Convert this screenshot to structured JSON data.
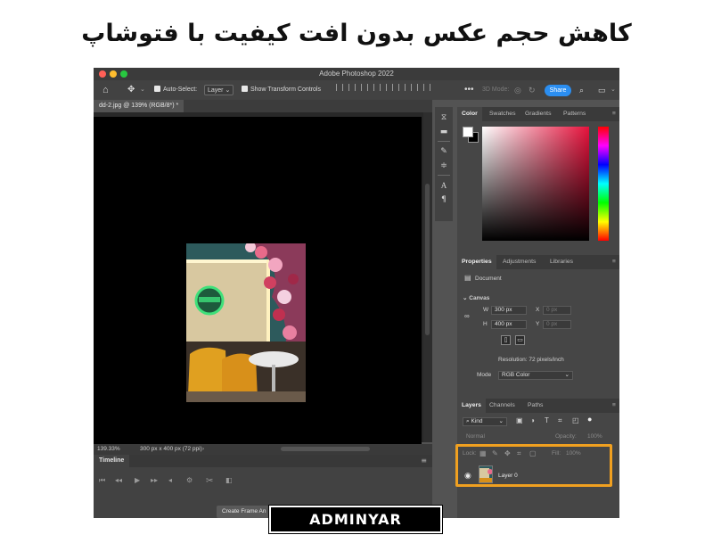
{
  "headline": "کاهش حجم عکس بدون افت کیفیت با فتوشاپ",
  "window": {
    "title": "Adobe Photoshop 2022"
  },
  "options_bar": {
    "auto_select_label": "Auto-Select:",
    "auto_select_value": "Layer",
    "show_transform_label": "Show Transform Controls",
    "mode_label": "3D Mode:",
    "share_label": "Share"
  },
  "document": {
    "tab_label": "dd-2.jpg @ 139% (RGB/8*) *"
  },
  "status": {
    "zoom": "139.33%",
    "info": "300 px x 400 px (72 ppi)"
  },
  "timeline": {
    "tab": "Timeline",
    "create_button": "Create Frame An"
  },
  "color_panel": {
    "tabs": [
      "Color",
      "Swatches",
      "Gradients",
      "Patterns"
    ],
    "foreground": "#ffffff",
    "background": "#000000"
  },
  "properties_panel": {
    "tabs": [
      "Properties",
      "Adjustments",
      "Libraries"
    ],
    "document_label": "Document",
    "canvas_label": "Canvas",
    "w_label": "W",
    "w_value": "300 px",
    "h_label": "H",
    "h_value": "400 px",
    "x_label": "X",
    "x_value": "0 px",
    "y_label": "Y",
    "y_value": "0 px",
    "resolution": "Resolution: 72 pixels/inch",
    "mode_label": "Mode",
    "mode_value": "RGB Color"
  },
  "layers_panel": {
    "tabs": [
      "Layers",
      "Channels",
      "Paths"
    ],
    "filter_kind": "Kind",
    "blend_mode": "Normal",
    "opacity_label": "Opacity:",
    "opacity_value": "100%",
    "lock_label": "Lock:",
    "fill_label": "Fill:",
    "fill_value": "100%",
    "layer_name": "Layer 0"
  },
  "highlight_color": "#f0a020",
  "watermark": "ADMINYAR"
}
